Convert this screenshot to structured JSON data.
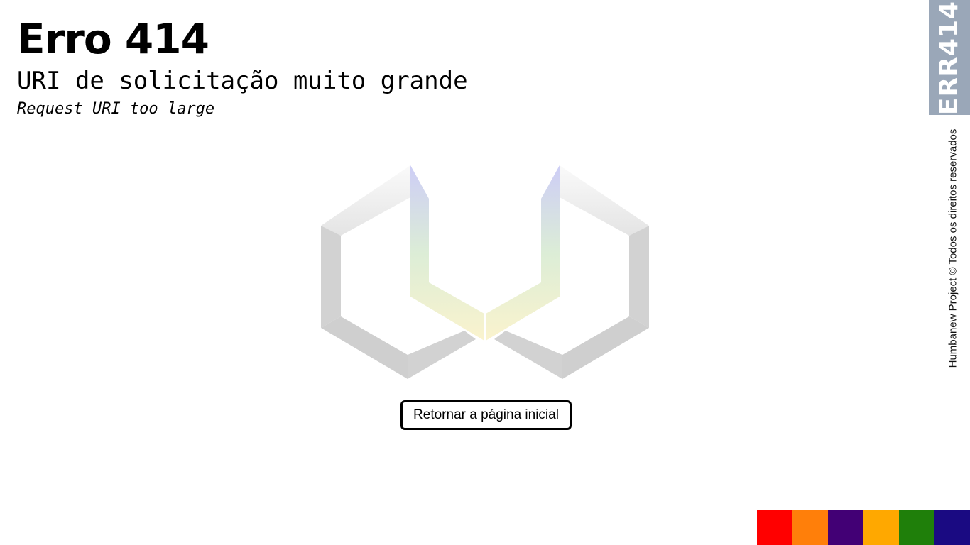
{
  "header": {
    "title": "Erro 414",
    "subtitle": "URI de solicitação muito grande",
    "subtitle_en": "Request URI too large"
  },
  "logo": {
    "icon": "hexagon-u-logo-icon",
    "colors": {
      "frame": "#d2d2d2",
      "frame_light": "#f0f0f0",
      "inner_top": "#c8c8f5",
      "inner_mid": "#d8ebd2",
      "inner_bottom": "#faf2c8"
    }
  },
  "actions": {
    "home_label": "Retornar a página inicial"
  },
  "side_panel": {
    "code_label": "ERR414",
    "code_bg": "#9aa7b8",
    "copyright": "Humbanew Project © Todos os direitos reservados"
  },
  "palette": [
    "#ff0000",
    "#ff7f0a",
    "#420075",
    "#ffa800",
    "#1f7f0a",
    "#1a0a82"
  ]
}
